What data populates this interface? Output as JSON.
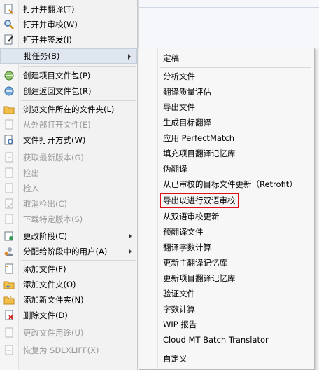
{
  "left_menu": {
    "items": [
      {
        "label": "打开并翻译(T)",
        "icon": "open-translate-icon",
        "disabled": false
      },
      {
        "label": "打开并审校(W)",
        "icon": "open-review-icon",
        "disabled": false
      },
      {
        "label": "打开并签发(I)",
        "icon": "open-signoff-icon",
        "disabled": false
      },
      {
        "label": "批任务(B)",
        "icon": "",
        "disabled": false,
        "submenu": true,
        "highlighted": true
      },
      {
        "label": "创建项目文件包(P)",
        "icon": "create-project-package-icon",
        "disabled": false
      },
      {
        "label": "创建返回文件包(R)",
        "icon": "create-return-package-icon",
        "disabled": false
      },
      {
        "label": "浏览文件所在的文件夹(L)",
        "icon": "folder-icon",
        "disabled": false
      },
      {
        "label": "从外部打开文件(E)",
        "icon": "external-open-icon",
        "disabled": true
      },
      {
        "label": "文件打开方式(W)",
        "icon": "open-with-icon",
        "disabled": false
      },
      {
        "label": "获取最新版本(G)",
        "icon": "get-latest-icon",
        "disabled": true
      },
      {
        "label": "检出",
        "icon": "checkout-icon",
        "disabled": true
      },
      {
        "label": "检入",
        "icon": "checkin-icon",
        "disabled": true
      },
      {
        "label": "取消检出(C)",
        "icon": "undo-checkout-icon",
        "disabled": true
      },
      {
        "label": "下载特定版本(S)",
        "icon": "download-version-icon",
        "disabled": true
      },
      {
        "label": "更改阶段(C)",
        "icon": "change-phase-icon",
        "disabled": false,
        "submenu": true
      },
      {
        "label": "分配给阶段中的用户(A)",
        "icon": "assign-user-icon",
        "disabled": false,
        "submenu": true
      },
      {
        "label": "添加文件(F)",
        "icon": "add-file-icon",
        "disabled": false
      },
      {
        "label": "添加文件夹(O)",
        "icon": "add-folder-icon",
        "disabled": false
      },
      {
        "label": "添加新文件夹(N)",
        "icon": "add-new-folder-icon",
        "disabled": false
      },
      {
        "label": "删除文件(D)",
        "icon": "delete-file-icon",
        "disabled": false
      },
      {
        "label": "更改文件用途(U)",
        "icon": "change-usage-icon",
        "disabled": true
      },
      {
        "label": "恢复为 SDLXLIFF(X)",
        "icon": "revert-sdlxliff-icon",
        "disabled": true
      }
    ]
  },
  "batch_submenu": {
    "items": [
      {
        "label": "定稿",
        "boxed": false
      },
      {
        "label": "分析文件",
        "boxed": false
      },
      {
        "label": "翻译质量评估",
        "boxed": false
      },
      {
        "label": "导出文件",
        "boxed": false
      },
      {
        "label": "生成目标翻译",
        "boxed": false
      },
      {
        "label": "应用 PerfectMatch",
        "boxed": false
      },
      {
        "label": "填充项目翻译记忆库",
        "boxed": false
      },
      {
        "label": "伪翻译",
        "boxed": false
      },
      {
        "label": "从已审校的目标文件更新（Retrofit）",
        "boxed": false
      },
      {
        "label": "导出以进行双语审校",
        "boxed": true
      },
      {
        "label": "从双语审校更新",
        "boxed": false
      },
      {
        "label": "预翻译文件",
        "boxed": false
      },
      {
        "label": "翻译字数计算",
        "boxed": false
      },
      {
        "label": "更新主翻译记忆库",
        "boxed": false
      },
      {
        "label": "更新项目翻译记忆库",
        "boxed": false
      },
      {
        "label": "验证文件",
        "boxed": false
      },
      {
        "label": "字数计算",
        "boxed": false
      },
      {
        "label": "WIP 报告",
        "boxed": false
      },
      {
        "label": "Cloud MT Batch Translator",
        "boxed": false
      },
      {
        "label": "自定义",
        "boxed": false
      }
    ]
  },
  "colors": {
    "highlight_box": "#e0101a",
    "disabled_text": "#9a9a9a",
    "hover_bg": "#dfe6ef"
  }
}
